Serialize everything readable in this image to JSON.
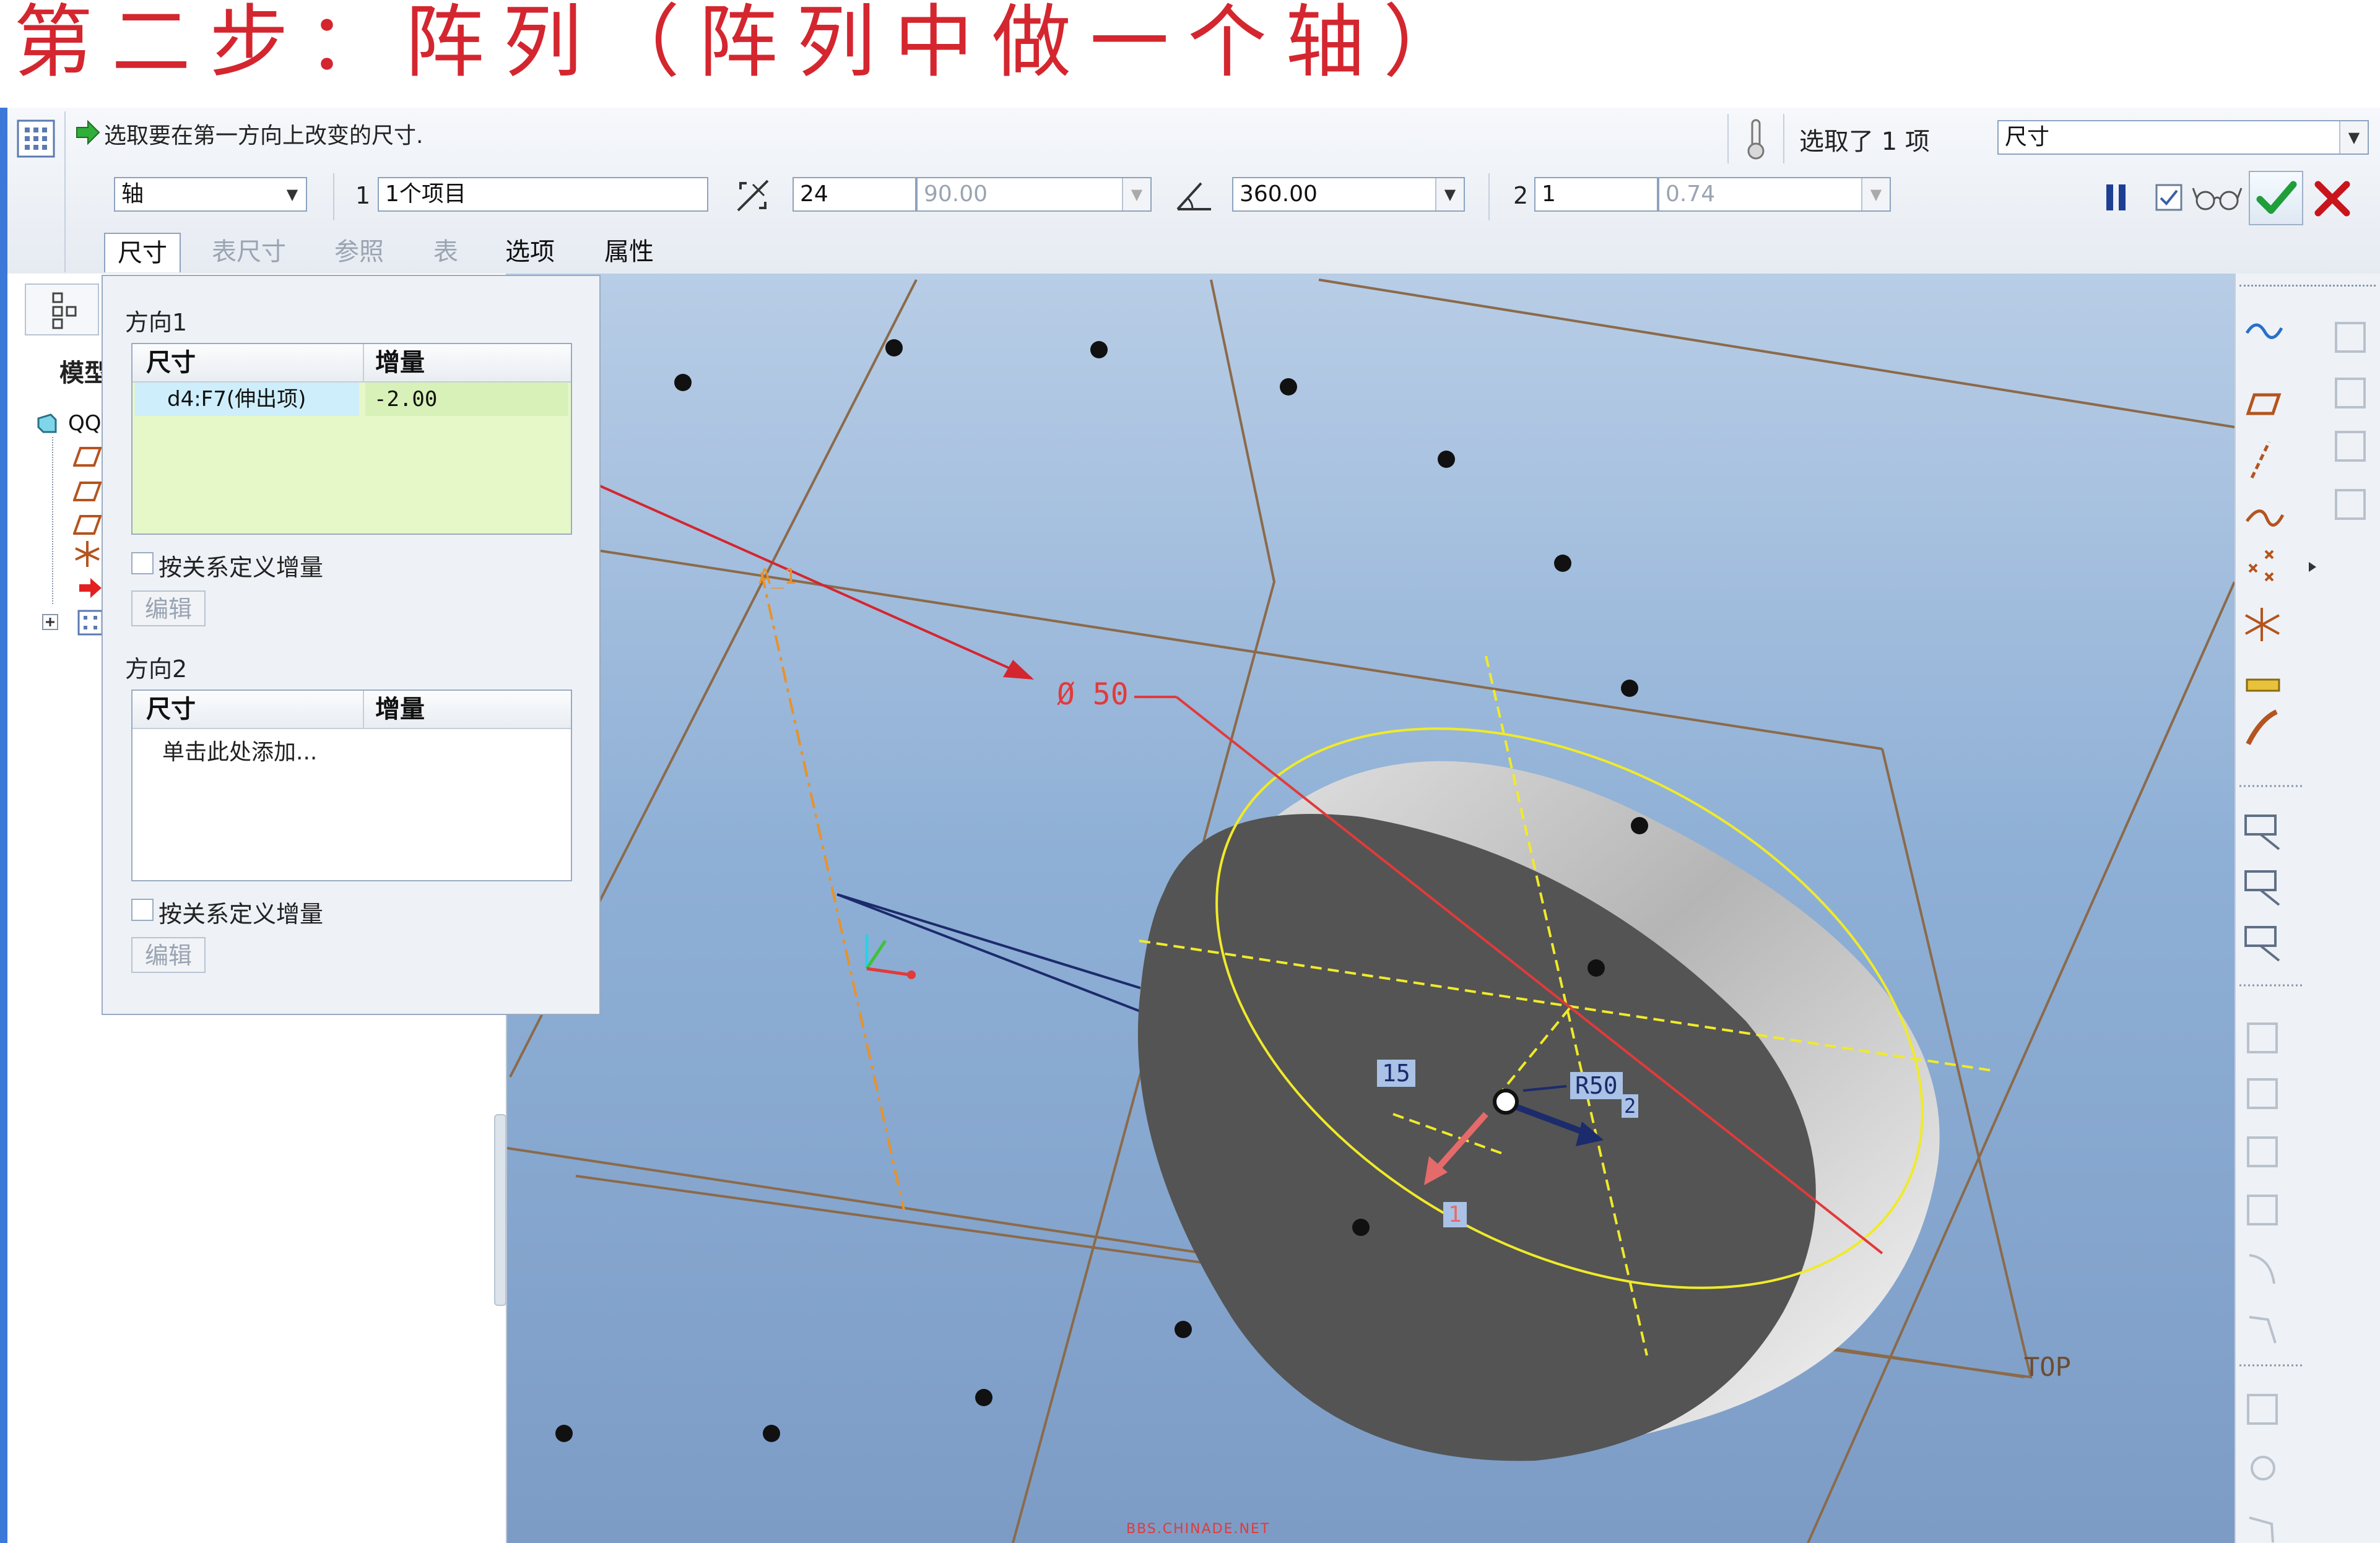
{
  "heading": "第二步：阵列（阵列中做一个轴）",
  "toolbar": {
    "prompt": "选取要在第一方向上改变的尺寸.",
    "selected_count_text": "选取了 1 项",
    "collector_select": "尺寸",
    "type_select": "轴",
    "dir1_number": "1",
    "dir1_items": "1个项目",
    "angular_count": "24",
    "angular_increment": "90.00",
    "angular_extent": "360.00",
    "dir2_number": "2",
    "radial_count": "1",
    "radial_spacing": "0.74"
  },
  "tabs": [
    {
      "label": "尺寸",
      "state": "active"
    },
    {
      "label": "表尺寸",
      "state": "disabled"
    },
    {
      "label": "参照",
      "state": "disabled"
    },
    {
      "label": "表",
      "state": "disabled"
    },
    {
      "label": "选项",
      "state": "enabled"
    },
    {
      "label": "属性",
      "state": "enabled"
    }
  ],
  "dialog": {
    "dir1_label": "方向1",
    "col_dimension": "尺寸",
    "col_increment": "增量",
    "dir1_row": {
      "dimension": "d4:F7(伸出项)",
      "increment": "-2.00"
    },
    "relation_checkbox": "按关系定义增量",
    "edit_button": "编辑",
    "dir2_label": "方向2",
    "dir2_placeholder": "单击此处添加...",
    "relation_checkbox2": "按关系定义增量",
    "edit_button2": "编辑"
  },
  "model_tree": {
    "tab_label": "模型",
    "root": "QQ"
  },
  "viewport_labels": {
    "diameter": "Ø 50",
    "angle": "15",
    "radius": "R50",
    "radius_sub": "2",
    "count": "1",
    "axis": "A_1",
    "plane": "TOP",
    "watermark": "BBS.CHINADE.NET"
  },
  "colors": {
    "heading": "#d4262f",
    "accent_blue": "#3b78d8",
    "row_highlight": "#cdeefa",
    "table_bg": "#e6f7c8",
    "confirm": "#1f9e3a",
    "cancel": "#c8151b"
  }
}
